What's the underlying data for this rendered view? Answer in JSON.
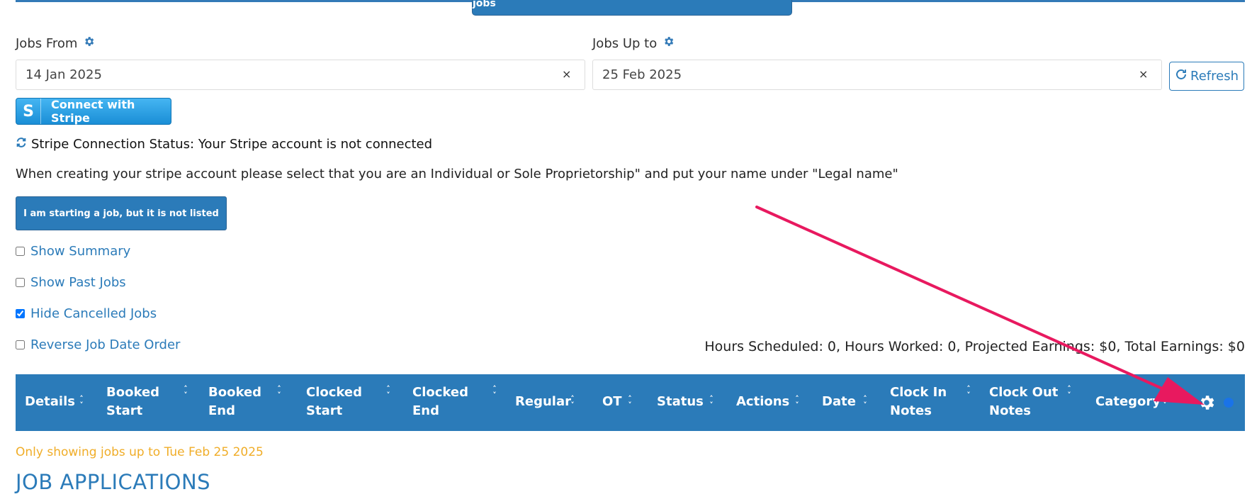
{
  "header": {
    "customize_label": "Customize Candidate experience settings with upcoming jobs"
  },
  "filters": {
    "jobs_from_label": "Jobs From",
    "jobs_from_value": "14 Jan 2025",
    "jobs_up_to_label": "Jobs Up to",
    "jobs_up_to_value": "25 Feb 2025",
    "clear_glyph": "×",
    "refresh_label": "Refresh"
  },
  "stripe": {
    "button_letter": "S",
    "button_label": "Connect with Stripe",
    "status_text": "Stripe Connection Status: Your Stripe account is not connected",
    "info_text": "When creating your stripe account please select that you are an Individual or Sole Proprietorship\" and put your name under \"Legal name\""
  },
  "actions": {
    "start_job_label": "I am starting a job, but it is not listed"
  },
  "options": [
    {
      "label": "Show Summary",
      "checked": false
    },
    {
      "label": "Show Past Jobs",
      "checked": false
    },
    {
      "label": "Hide Cancelled Jobs",
      "checked": true
    },
    {
      "label": "Reverse Job Date Order",
      "checked": false
    }
  ],
  "summary_text": "Hours Scheduled: 0, Hours Worked: 0, Projected Earnings: $0, Total Earnings: $0",
  "table": {
    "columns": [
      {
        "line1": "Details",
        "line2": ""
      },
      {
        "line1": "Booked",
        "line2": "Start"
      },
      {
        "line1": "Booked",
        "line2": "End"
      },
      {
        "line1": "Clocked",
        "line2": "Start"
      },
      {
        "line1": "Clocked",
        "line2": "End"
      },
      {
        "line1": "Regular",
        "line2": ""
      },
      {
        "line1": "OT",
        "line2": ""
      },
      {
        "line1": "Status",
        "line2": ""
      },
      {
        "line1": "Actions",
        "line2": ""
      },
      {
        "line1": "Date",
        "line2": ""
      },
      {
        "line1": "Clock In",
        "line2": "Notes"
      },
      {
        "line1": "Clock Out",
        "line2": "Notes"
      },
      {
        "line1": "Category",
        "line2": ""
      }
    ],
    "header_color": "#2b7bb9"
  },
  "notice_text": "Only showing jobs up to Tue Feb 25 2025",
  "section_title": "JOB APPLICATIONS",
  "colors": {
    "primary": "#2b7bb9",
    "warning": "#f0ad28",
    "arrow": "#e8195f"
  }
}
